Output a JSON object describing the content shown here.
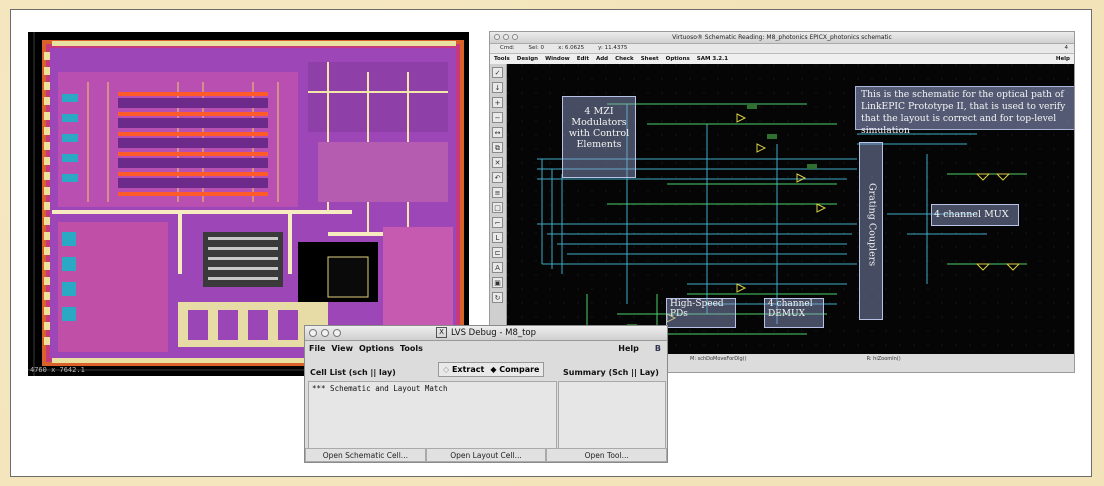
{
  "layout_view": {
    "coord_readout": "4760 x 7642.1"
  },
  "schematic_window": {
    "title": "Virtuoso® Schematic Reading: M8_photonics EPICX_photonics schematic",
    "status": [
      "Cmd:",
      "Sel: 0",
      "x:  6.0625",
      "y:  11.4375"
    ],
    "status_right": "4",
    "menu": [
      "Tools",
      "Design",
      "Window",
      "Edit",
      "Add",
      "Check",
      "Sheet",
      "Options",
      "SAM 3.2.1"
    ],
    "menu_right": "Help",
    "annotations": {
      "description": "This is the schematic for the optical path of LinkEPIC Prototype II, that is used to verify that the layout is correct and for top-level simulation",
      "mzi": "4 MZI Modulators with Control Elements",
      "grating": "Grating Couplers",
      "mux": "4 channel MUX",
      "pds": "High-Speed PDs",
      "demux": "4 channel DEMUX"
    },
    "bottom_status": [
      "M: schDoMoveForDlg()",
      "R: hiZoomIn()"
    ]
  },
  "lvs_debug": {
    "title": "LVS Debug - M8_top",
    "menu": [
      "File",
      "View",
      "Options",
      "Tools"
    ],
    "help": "Help",
    "cell_list_label": "Cell List (sch || lay)",
    "extract_label": "Extract",
    "compare_label": "Compare",
    "summary_label": "Summary (Sch || Lay)",
    "list_items": [
      "*** Schematic and Layout Match"
    ],
    "buttons": [
      "Open Schematic Cell...",
      "Open Layout Cell...",
      "Open Tool..."
    ]
  }
}
